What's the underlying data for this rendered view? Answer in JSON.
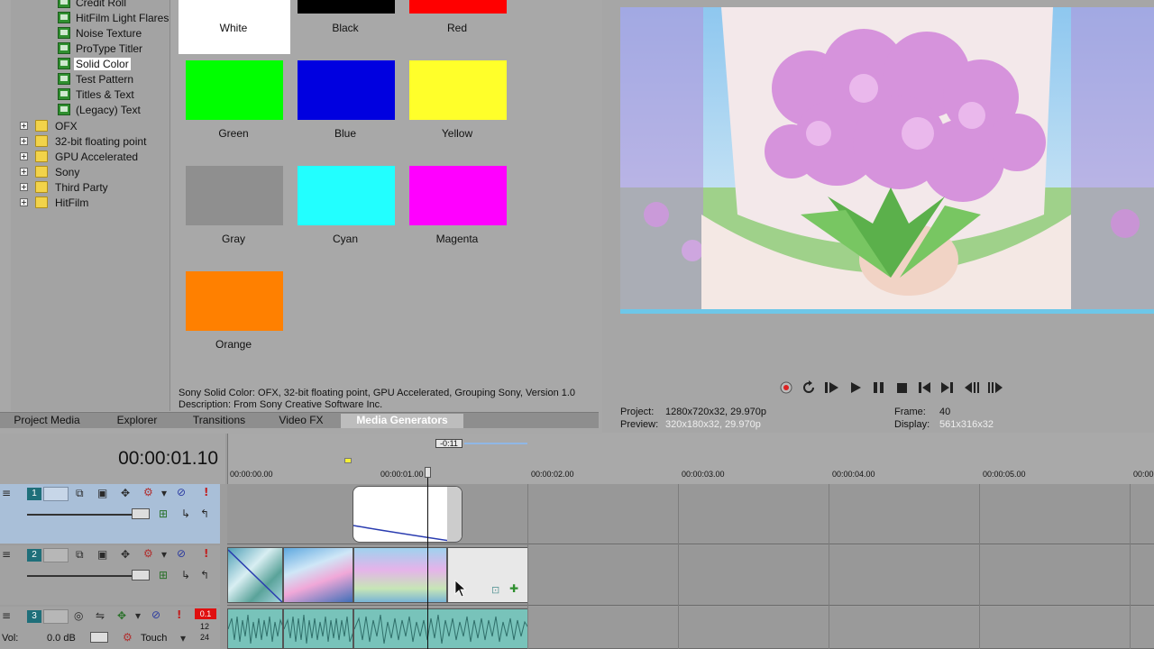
{
  "tree": {
    "generator_items": [
      {
        "label": "Credit Roll",
        "selected": false
      },
      {
        "label": "HitFilm Light Flares",
        "selected": false
      },
      {
        "label": "Noise Texture",
        "selected": false
      },
      {
        "label": "ProType Titler",
        "selected": false
      },
      {
        "label": "Solid Color",
        "selected": true
      },
      {
        "label": "Test Pattern",
        "selected": false
      },
      {
        "label": "Titles & Text",
        "selected": false
      },
      {
        "label": "(Legacy) Text",
        "selected": false
      }
    ],
    "folders": [
      "OFX",
      "32-bit floating point",
      "GPU Accelerated",
      "Sony",
      "Third Party",
      "HitFilm"
    ]
  },
  "swatches": [
    {
      "label": "White",
      "color": "#ffffff"
    },
    {
      "label": "Black",
      "color": "#000000"
    },
    {
      "label": "Red",
      "color": "#ff0000"
    },
    {
      "label": "Green",
      "color": "#00ff00"
    },
    {
      "label": "Blue",
      "color": "#0000e0"
    },
    {
      "label": "Yellow",
      "color": "#ffff2a"
    },
    {
      "label": "Gray",
      "color": "#8f8f8f"
    },
    {
      "label": "Cyan",
      "color": "#22ffff"
    },
    {
      "label": "Magenta",
      "color": "#ff00ff"
    },
    {
      "label": "Orange",
      "color": "#ff8000"
    }
  ],
  "description": {
    "line1": "Sony Solid Color: OFX, 32-bit floating point, GPU Accelerated, Grouping Sony, Version 1.0",
    "line2": "Description: From Sony Creative Software Inc."
  },
  "tabs": [
    "Project Media",
    "Explorer",
    "Transitions",
    "Video FX",
    "Media Generators"
  ],
  "active_tab": "Media Generators",
  "preview": {
    "project_label": "Project:",
    "project_value": "1280x720x32, 29.970p",
    "preview_label": "Preview:",
    "preview_value": "320x180x32, 29.970p",
    "frame_label": "Frame:",
    "frame_value": "40",
    "display_label": "Display:",
    "display_value": "561x316x32"
  },
  "timeline": {
    "timecode": "00:00:01.10",
    "marker_label": "-0:11",
    "ruler_ticks": [
      "00:00:00.00",
      "00:00:01.00",
      "00:00:02.00",
      "00:00:03.00",
      "00:00:04.00",
      "00:00:05.00",
      "00:00:0"
    ],
    "tracks": [
      {
        "number": "1",
        "type": "video"
      },
      {
        "number": "2",
        "type": "video"
      },
      {
        "number": "3",
        "type": "audio",
        "vol_label": "Vol:",
        "vol_value": "0.0 dB",
        "mode": "Touch",
        "meter_top": "0.1",
        "meter_a": "12",
        "meter_b": "24"
      }
    ]
  }
}
